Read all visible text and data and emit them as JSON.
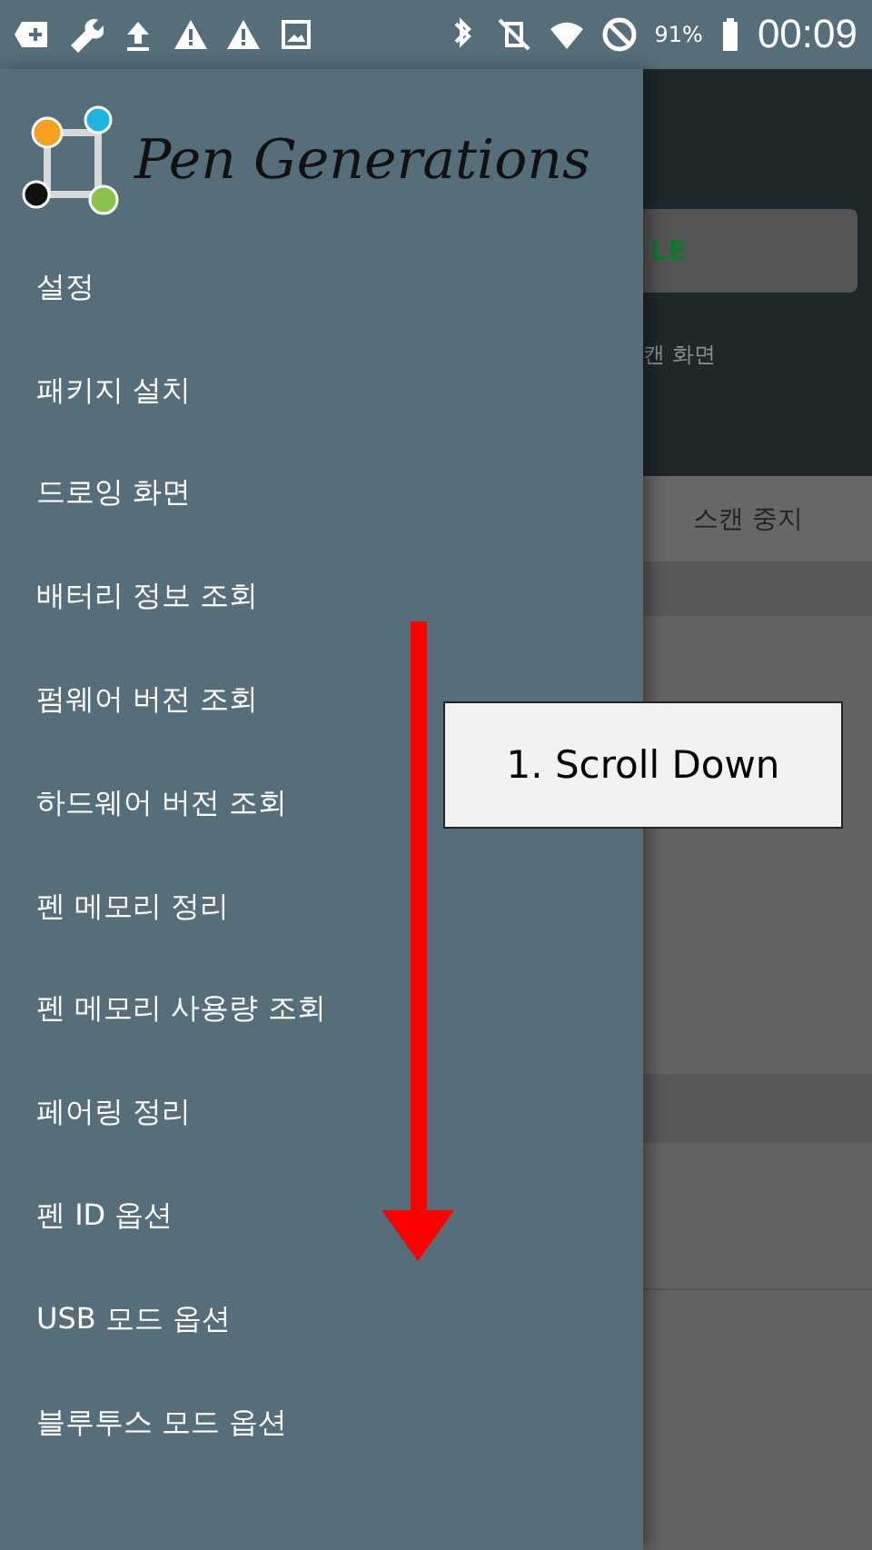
{
  "status_bar": {
    "battery_percent": "91%",
    "time": "00:09"
  },
  "background_screen": {
    "button_label": "LE",
    "caption": "캔 화면",
    "tab_label": "스캔 중지"
  },
  "drawer": {
    "logo_text": "Pen Generations",
    "items": [
      {
        "label": "설정"
      },
      {
        "label": "패키지 설치"
      },
      {
        "label": "드로잉 화면"
      },
      {
        "label": "배터리 정보 조회"
      },
      {
        "label": "펌웨어 버전 조회"
      },
      {
        "label": "하드웨어 버전 조회"
      },
      {
        "label": "펜 메모리 정리"
      },
      {
        "label": "펜 메모리 사용량 조회"
      },
      {
        "label": "페어링 정리"
      },
      {
        "label": "펜 ID 옵션"
      },
      {
        "label": "USB 모드 옵션"
      },
      {
        "label": "블루투스 모드 옵션"
      }
    ]
  },
  "annotation": {
    "label": "1. Scroll Down"
  }
}
